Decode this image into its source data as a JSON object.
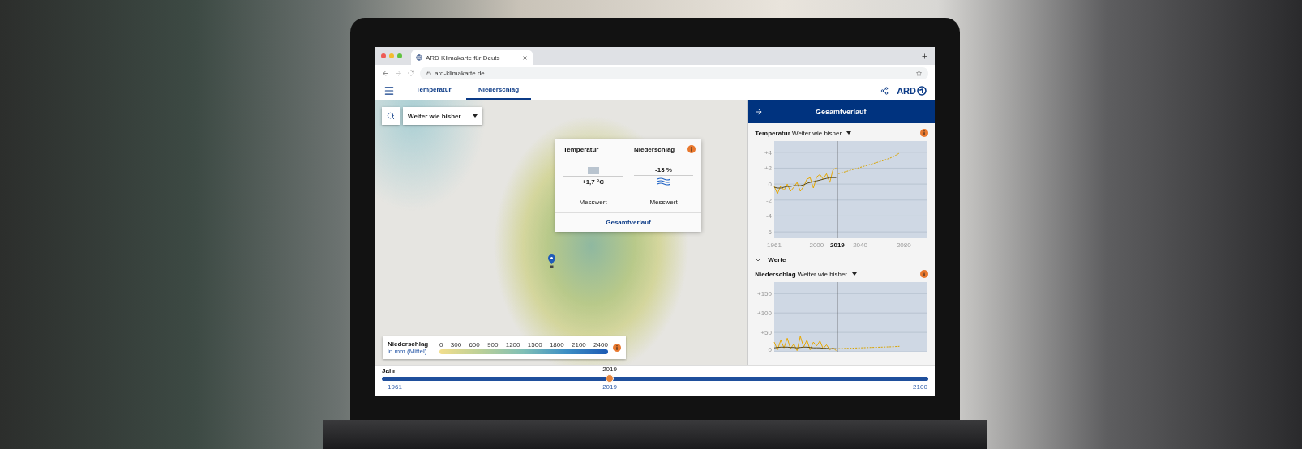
{
  "browser": {
    "tab_title": "ARD Klimakarte für Deuts",
    "url": "ard-klimakarte.de"
  },
  "header": {
    "tabs": [
      {
        "label": "Temperatur",
        "selected": false
      },
      {
        "label": "Niederschlag",
        "selected": true
      }
    ],
    "logo": "ARD"
  },
  "map": {
    "scenario": "Weiter wie bisher",
    "popup": {
      "columns": [
        {
          "title": "Temperatur",
          "kind": "bar",
          "value": "+1,7 °C",
          "note": "Messwert"
        },
        {
          "title": "Niederschlag",
          "kind": "waves",
          "value": "-13 %",
          "note": "Messwert"
        }
      ],
      "link": "Gesamtverlauf"
    },
    "legend": {
      "title": "Niederschlag",
      "subtitle": "in mm (Mittel)",
      "ticks": [
        "0",
        "300",
        "600",
        "900",
        "1200",
        "1500",
        "1800",
        "2100",
        "2400"
      ]
    }
  },
  "panel": {
    "title": "Gesamtverlauf",
    "charts": [
      {
        "title": "**Temperatur** Weiter wie bisher",
        "values_toggle": {
          "label": "Werte",
          "expanded": false
        },
        "chart_data": {
          "type": "line",
          "x": [
            1961,
            1964,
            1967,
            1970,
            1973,
            1976,
            1979,
            1982,
            1985,
            1988,
            1991,
            1994,
            1997,
            2000,
            2003,
            2006,
            2009,
            2012,
            2015,
            2018,
            2020,
            2030,
            2040,
            2050,
            2060,
            2070,
            2076
          ],
          "xlim": [
            1961,
            2101
          ],
          "ylim": [
            -6.8,
            5.4
          ],
          "xticks": [
            1961,
            2000,
            2019,
            2040,
            2080
          ],
          "yticks": [
            {
              "value": 4,
              "label": "+4"
            },
            {
              "value": 2,
              "label": "+2"
            },
            0,
            -2,
            -4,
            -6
          ],
          "grid": true,
          "ref_lines": [
            {
              "axis": "x",
              "value": 2019
            }
          ],
          "series": [
            {
              "color": "#e8a800",
              "line_style": "solid",
              "values": [
                -0.3,
                -1.2,
                -0.2,
                -0.8,
                0.0,
                -0.9,
                -0.4,
                0.2,
                -0.9,
                -0.3,
                0.6,
                0.8,
                -0.5,
                0.9,
                1.2,
                0.6,
                1.3,
                0.2,
                1.8,
                2.0,
                null,
                null,
                null,
                null,
                null,
                null,
                null
              ]
            },
            {
              "color": "#5a4a1a",
              "line_style": "solid",
              "values": [
                -0.4,
                -0.5,
                -0.5,
                -0.4,
                -0.3,
                -0.3,
                -0.2,
                -0.2,
                -0.2,
                -0.1,
                0.1,
                0.2,
                0.3,
                0.4,
                0.5,
                0.6,
                0.7,
                0.8,
                0.8,
                0.8,
                null,
                null,
                null,
                null,
                null,
                null,
                null
              ]
            },
            {
              "color": "#d9a400",
              "line_style": "dashed",
              "values": [
                null,
                null,
                null,
                null,
                null,
                null,
                null,
                null,
                null,
                null,
                null,
                null,
                null,
                null,
                null,
                null,
                null,
                null,
                null,
                null,
                1.3,
                1.7,
                2.1,
                2.5,
                2.9,
                3.4,
                3.9
              ]
            }
          ]
        }
      },
      {
        "title": "**Niederschlag** Weiter wie bisher",
        "chart_data": {
          "type": "line",
          "x": [
            1961,
            1964,
            1967,
            1970,
            1973,
            1976,
            1979,
            1982,
            1985,
            1988,
            1991,
            1994,
            1997,
            2000,
            2003,
            2006,
            2009,
            2012,
            2015,
            2018,
            2020,
            2030,
            2040,
            2050,
            2060,
            2070,
            2076
          ],
          "xlim": [
            1961,
            2101
          ],
          "ylim": [
            0,
            180
          ],
          "yticks": [
            {
              "value": 150,
              "label": "+150"
            },
            {
              "value": 100,
              "label": "+100"
            },
            {
              "value": 50,
              "label": "+50"
            },
            0
          ],
          "grid": true,
          "ref_lines": [
            {
              "axis": "x",
              "value": 2019
            }
          ],
          "series": [
            {
              "color": "#e8a800",
              "line_style": "solid",
              "values": [
                25,
                5,
                30,
                10,
                35,
                8,
                20,
                3,
                40,
                12,
                30,
                5,
                25,
                15,
                28,
                8,
                18,
                5,
                10,
                3,
                null,
                null,
                null,
                null,
                null,
                null,
                null
              ]
            },
            {
              "color": "#5a4a1a",
              "line_style": "solid",
              "values": [
                10,
                11,
                12,
                12,
                12,
                11,
                11,
                10,
                11,
                12,
                12,
                11,
                10,
                10,
                10,
                9,
                9,
                8,
                8,
                8,
                null,
                null,
                null,
                null,
                null,
                null,
                null
              ]
            },
            {
              "color": "#d9a400",
              "line_style": "dashed",
              "values": [
                null,
                null,
                null,
                null,
                null,
                null,
                null,
                null,
                null,
                null,
                null,
                null,
                null,
                null,
                null,
                null,
                null,
                null,
                null,
                null,
                8,
                9,
                10,
                11,
                12,
                13,
                14
              ]
            }
          ]
        }
      }
    ]
  },
  "timeline": {
    "label": "Jahr",
    "selected_year": "2019",
    "start": "1961",
    "current": "2019",
    "end": "2100",
    "level": 0.417
  }
}
